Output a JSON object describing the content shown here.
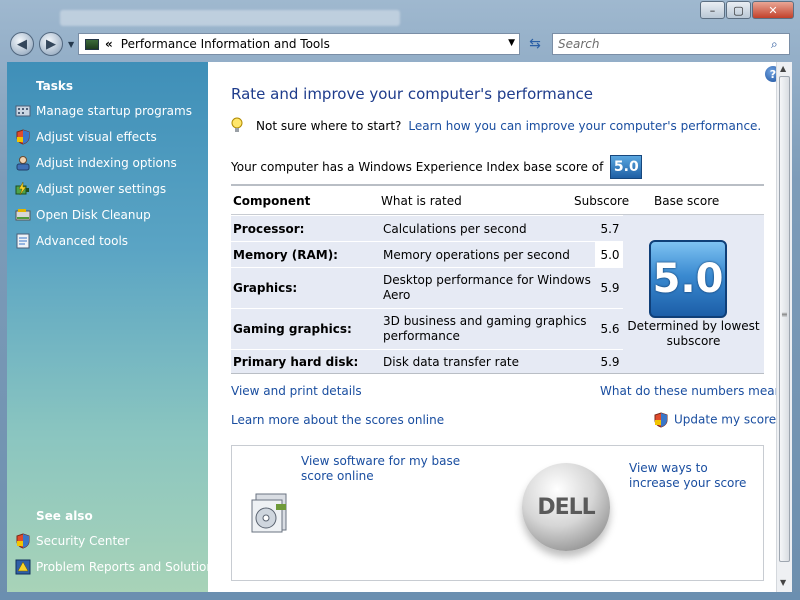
{
  "window": {
    "minimize_glyph": "–",
    "maximize_glyph": "▢",
    "close_glyph": "✕"
  },
  "nav": {
    "back_glyph": "◀",
    "forward_glyph": "▶",
    "address_chevron": "«",
    "address_text": "Performance Information and Tools",
    "search_placeholder": "Search"
  },
  "left_pane": {
    "tasks_title": "Tasks",
    "tasks": [
      {
        "label": "Manage startup programs",
        "icon": "startup-programs-icon"
      },
      {
        "label": "Adjust visual effects",
        "icon": "shield-icon"
      },
      {
        "label": "Adjust indexing options",
        "icon": "indexing-icon"
      },
      {
        "label": "Adjust power settings",
        "icon": "power-icon"
      },
      {
        "label": "Open Disk Cleanup",
        "icon": "disk-cleanup-icon"
      },
      {
        "label": "Advanced tools",
        "icon": "advanced-tools-icon"
      }
    ],
    "see_also_title": "See also",
    "see_also": [
      {
        "label": "Security Center",
        "icon": "security-center-icon"
      },
      {
        "label": "Problem Reports and Solutions",
        "icon": "problem-reports-icon"
      }
    ]
  },
  "main": {
    "heading": "Rate and improve your computer's performance",
    "tip_question": "Not sure where to start?",
    "tip_link": "Learn how you can improve your computer's performance.",
    "score_line": "Your computer has a Windows Experience Index base score of",
    "base_score": "5.0",
    "table": {
      "headers": {
        "component": "Component",
        "what": "What is rated",
        "subscore": "Subscore",
        "base": "Base score"
      },
      "rows": [
        {
          "component": "Processor:",
          "what": "Calculations per second",
          "subscore": "5.7"
        },
        {
          "component": "Memory (RAM):",
          "what": "Memory operations per second",
          "subscore": "5.0"
        },
        {
          "component": "Graphics:",
          "what": "Desktop performance for Windows Aero",
          "subscore": "5.9"
        },
        {
          "component": "Gaming graphics:",
          "what": "3D business and gaming graphics performance",
          "subscore": "5.6"
        },
        {
          "component": "Primary hard disk:",
          "what": "Disk data transfer rate",
          "subscore": "5.9"
        }
      ],
      "big_score": "5.0",
      "determined_text": "Determined by lowest subscore"
    },
    "links": {
      "view_print": "View and print details",
      "what_mean": "What do these numbers mean?",
      "learn_online": "Learn more about the scores online",
      "update": "Update my score"
    },
    "offers": {
      "software_link": "View software for my base score online",
      "ways_link": "View ways to increase your score",
      "dell_logo": "DELL"
    }
  }
}
